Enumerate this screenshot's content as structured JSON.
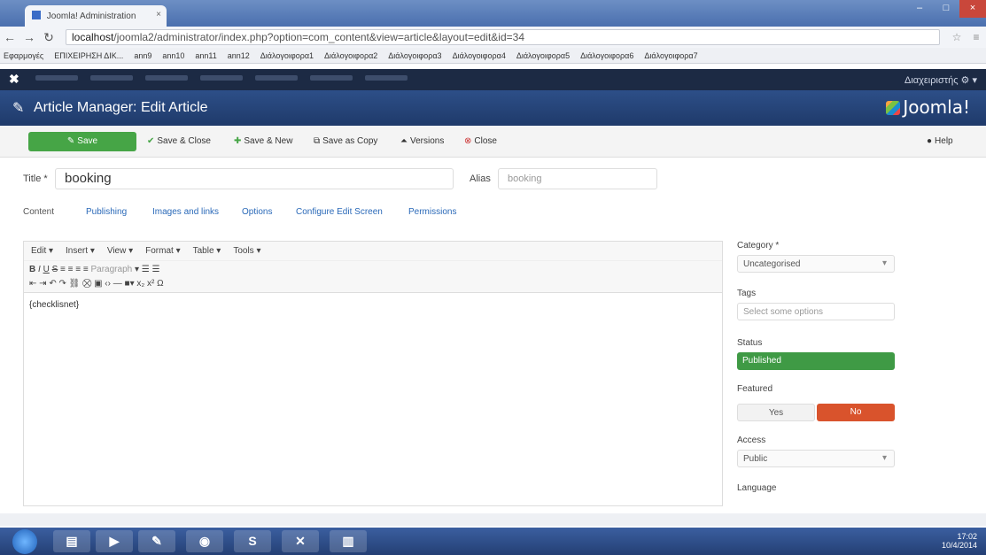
{
  "browser": {
    "tab_title": "Joomla! Administration",
    "tab_close": "×",
    "url_host": "localhost",
    "url_path": "/joomla2/administrator/index.php?option=com_content&view=article&layout=edit&id=34",
    "bookmarks": [
      "Εφαρμογές",
      "ΕΠΙΧΕΙΡΗΣΗ ΔΙΚ...",
      "ann9",
      "ann10",
      "ann11",
      "ann12",
      "Διάλογοιφορα1",
      "Διάλογοιφορα2",
      "Διάλογοιφορα3",
      "Διάλογοιφορα4",
      "Διάλογοιφορα5",
      "Διάλογοιφορα6",
      "Διάλογοιφορα7"
    ]
  },
  "joomla": {
    "user_menu": "Διαχειριστής",
    "page_title": "Article Manager: Edit Article",
    "logo_text": "Joomla!"
  },
  "toolbar": {
    "save": "Save",
    "save_close": "Save & Close",
    "save_new": "Save & New",
    "save_copy": "Save as Copy",
    "versions": "Versions",
    "close": "Close",
    "help": "Help"
  },
  "form": {
    "title_label": "Title *",
    "title_value": "booking",
    "alias_label": "Alias",
    "alias_value": "booking"
  },
  "tabs": [
    "Content",
    "Publishing",
    "Images and links",
    "Options",
    "Configure Edit Screen",
    "Permissions"
  ],
  "editor": {
    "menu": [
      "Edit ▾",
      "Insert ▾",
      "View ▾",
      "Format ▾",
      "Table ▾",
      "Tools ▾"
    ],
    "paragraph": "Paragraph",
    "content": "{checklisnet}"
  },
  "sidebar": {
    "category_label": "Category *",
    "category_value": "Uncategorised",
    "tags_label": "Tags",
    "tags_placeholder": "Select some options",
    "status_label": "Status",
    "status_value": "Published",
    "featured_label": "Featured",
    "featured_yes": "Yes",
    "featured_no": "No",
    "access_label": "Access",
    "access_value": "Public",
    "language_label": "Language"
  },
  "taskbar": {
    "clock_time": "17:02",
    "clock_date": "10/4/2014"
  },
  "colors": {
    "save_green": "#46a546",
    "header_blue": "#2d4f88",
    "nav_dark": "#1c2a44",
    "no_red": "#d9532c"
  }
}
